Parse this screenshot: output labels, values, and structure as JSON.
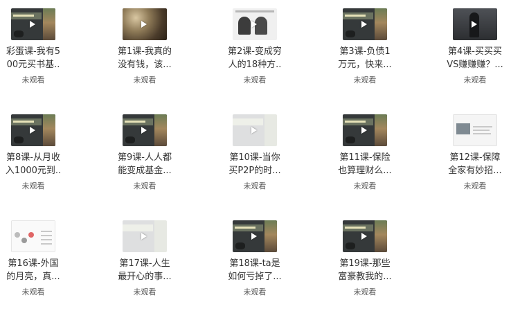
{
  "status_label": "未观看",
  "lessons": [
    {
      "line1": "彩蛋课-我有5",
      "line2": "00元买书基..",
      "status": "未观看",
      "thumb": "dark"
    },
    {
      "line1": "第1课-我真的",
      "line2": "没有钱，该...",
      "status": "未观看",
      "thumb": "food"
    },
    {
      "line1": "第2课-变成穷",
      "line2": "人的18种方..",
      "status": "未观看",
      "thumb": "people"
    },
    {
      "line1": "第3课-负债1",
      "line2": "万元，快来...",
      "status": "未观看",
      "thumb": "dark"
    },
    {
      "line1": "第4课-买买买",
      "line2": "VS赚赚赚？...",
      "status": "未观看",
      "thumb": "silhouette"
    },
    {
      "line1": "第8课-从月收",
      "line2": "入1000元到..",
      "status": "未观看",
      "thumb": "dark"
    },
    {
      "line1": "第9课-人人都",
      "line2": "能变成基金...",
      "status": "未观看",
      "thumb": "dark"
    },
    {
      "line1": "第10课-当你",
      "line2": "买P2P的时...",
      "status": "未观看",
      "thumb": "faded"
    },
    {
      "line1": "第11课-保险",
      "line2": "也算理财么...",
      "status": "未观看",
      "thumb": "dark"
    },
    {
      "line1": "第12课-保障",
      "line2": "全家有妙招...",
      "status": "未观看",
      "thumb": "slide"
    },
    {
      "line1": "第16课-外国",
      "line2": "的月亮，真...",
      "status": "未观看",
      "thumb": "chart"
    },
    {
      "line1": "第17课-人生",
      "line2": "最开心的事...",
      "status": "未观看",
      "thumb": "faded"
    },
    {
      "line1": "第18课-ta是",
      "line2": "如何亏掉了...",
      "status": "未观看",
      "thumb": "dark"
    },
    {
      "line1": "第19课-那些",
      "line2": "富豪教我的...",
      "status": "未观看",
      "thumb": "dark"
    }
  ]
}
